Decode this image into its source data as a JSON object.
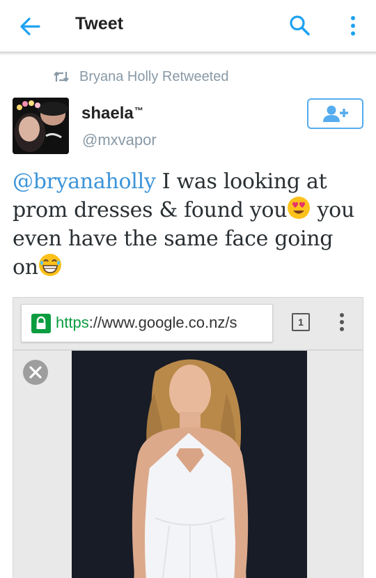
{
  "app_bar": {
    "title": "Tweet",
    "back_icon": "arrow-left-icon",
    "search_icon": "search-icon",
    "overflow_icon": "more-vertical-icon",
    "accent": "#1da1f2"
  },
  "retweet_context": {
    "text": "Bryana Holly Retweeted",
    "icon": "retweet-icon"
  },
  "author": {
    "name": "shaela",
    "name_suffix": "™",
    "handle": "@mxvapor",
    "follow_icon": "add-user-icon"
  },
  "tweet": {
    "mention": "@bryanaholly",
    "text_part1": " I was looking at prom dresses & found you",
    "emoji1": "heart-eyes-emoji",
    "text_part2": " you even have the same face going on",
    "emoji2": "grinning-squint-emoji",
    "mention_color": "#3b94d9"
  },
  "media": {
    "url_scheme": "https",
    "url_rest": "://www.google.co.nz/s",
    "tab_count": "1",
    "lock_icon": "lock-icon",
    "close_icon": "close-icon",
    "menu_icon": "more-vertical-icon",
    "secure_color": "#0b9d40"
  }
}
